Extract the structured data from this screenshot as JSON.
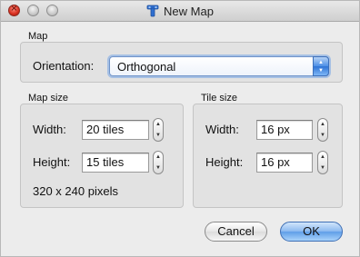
{
  "window": {
    "title": "New Map",
    "icons": {
      "close": "close-icon",
      "app": "tiled-app-icon"
    }
  },
  "map_group": {
    "label": "Map",
    "orientation_label": "Orientation:",
    "orientation_value": "Orthogonal"
  },
  "map_size_group": {
    "label": "Map size",
    "width_label": "Width:",
    "width_value": "20 tiles",
    "height_label": "Height:",
    "height_value": "15 tiles",
    "pixels_text": "320 x 240 pixels"
  },
  "tile_size_group": {
    "label": "Tile size",
    "width_label": "Width:",
    "width_value": "16 px",
    "height_label": "Height:",
    "height_value": "16 px"
  },
  "buttons": {
    "cancel": "Cancel",
    "ok": "OK"
  },
  "colors": {
    "accent": "#4b8ee6",
    "window_bg": "#ececec"
  }
}
